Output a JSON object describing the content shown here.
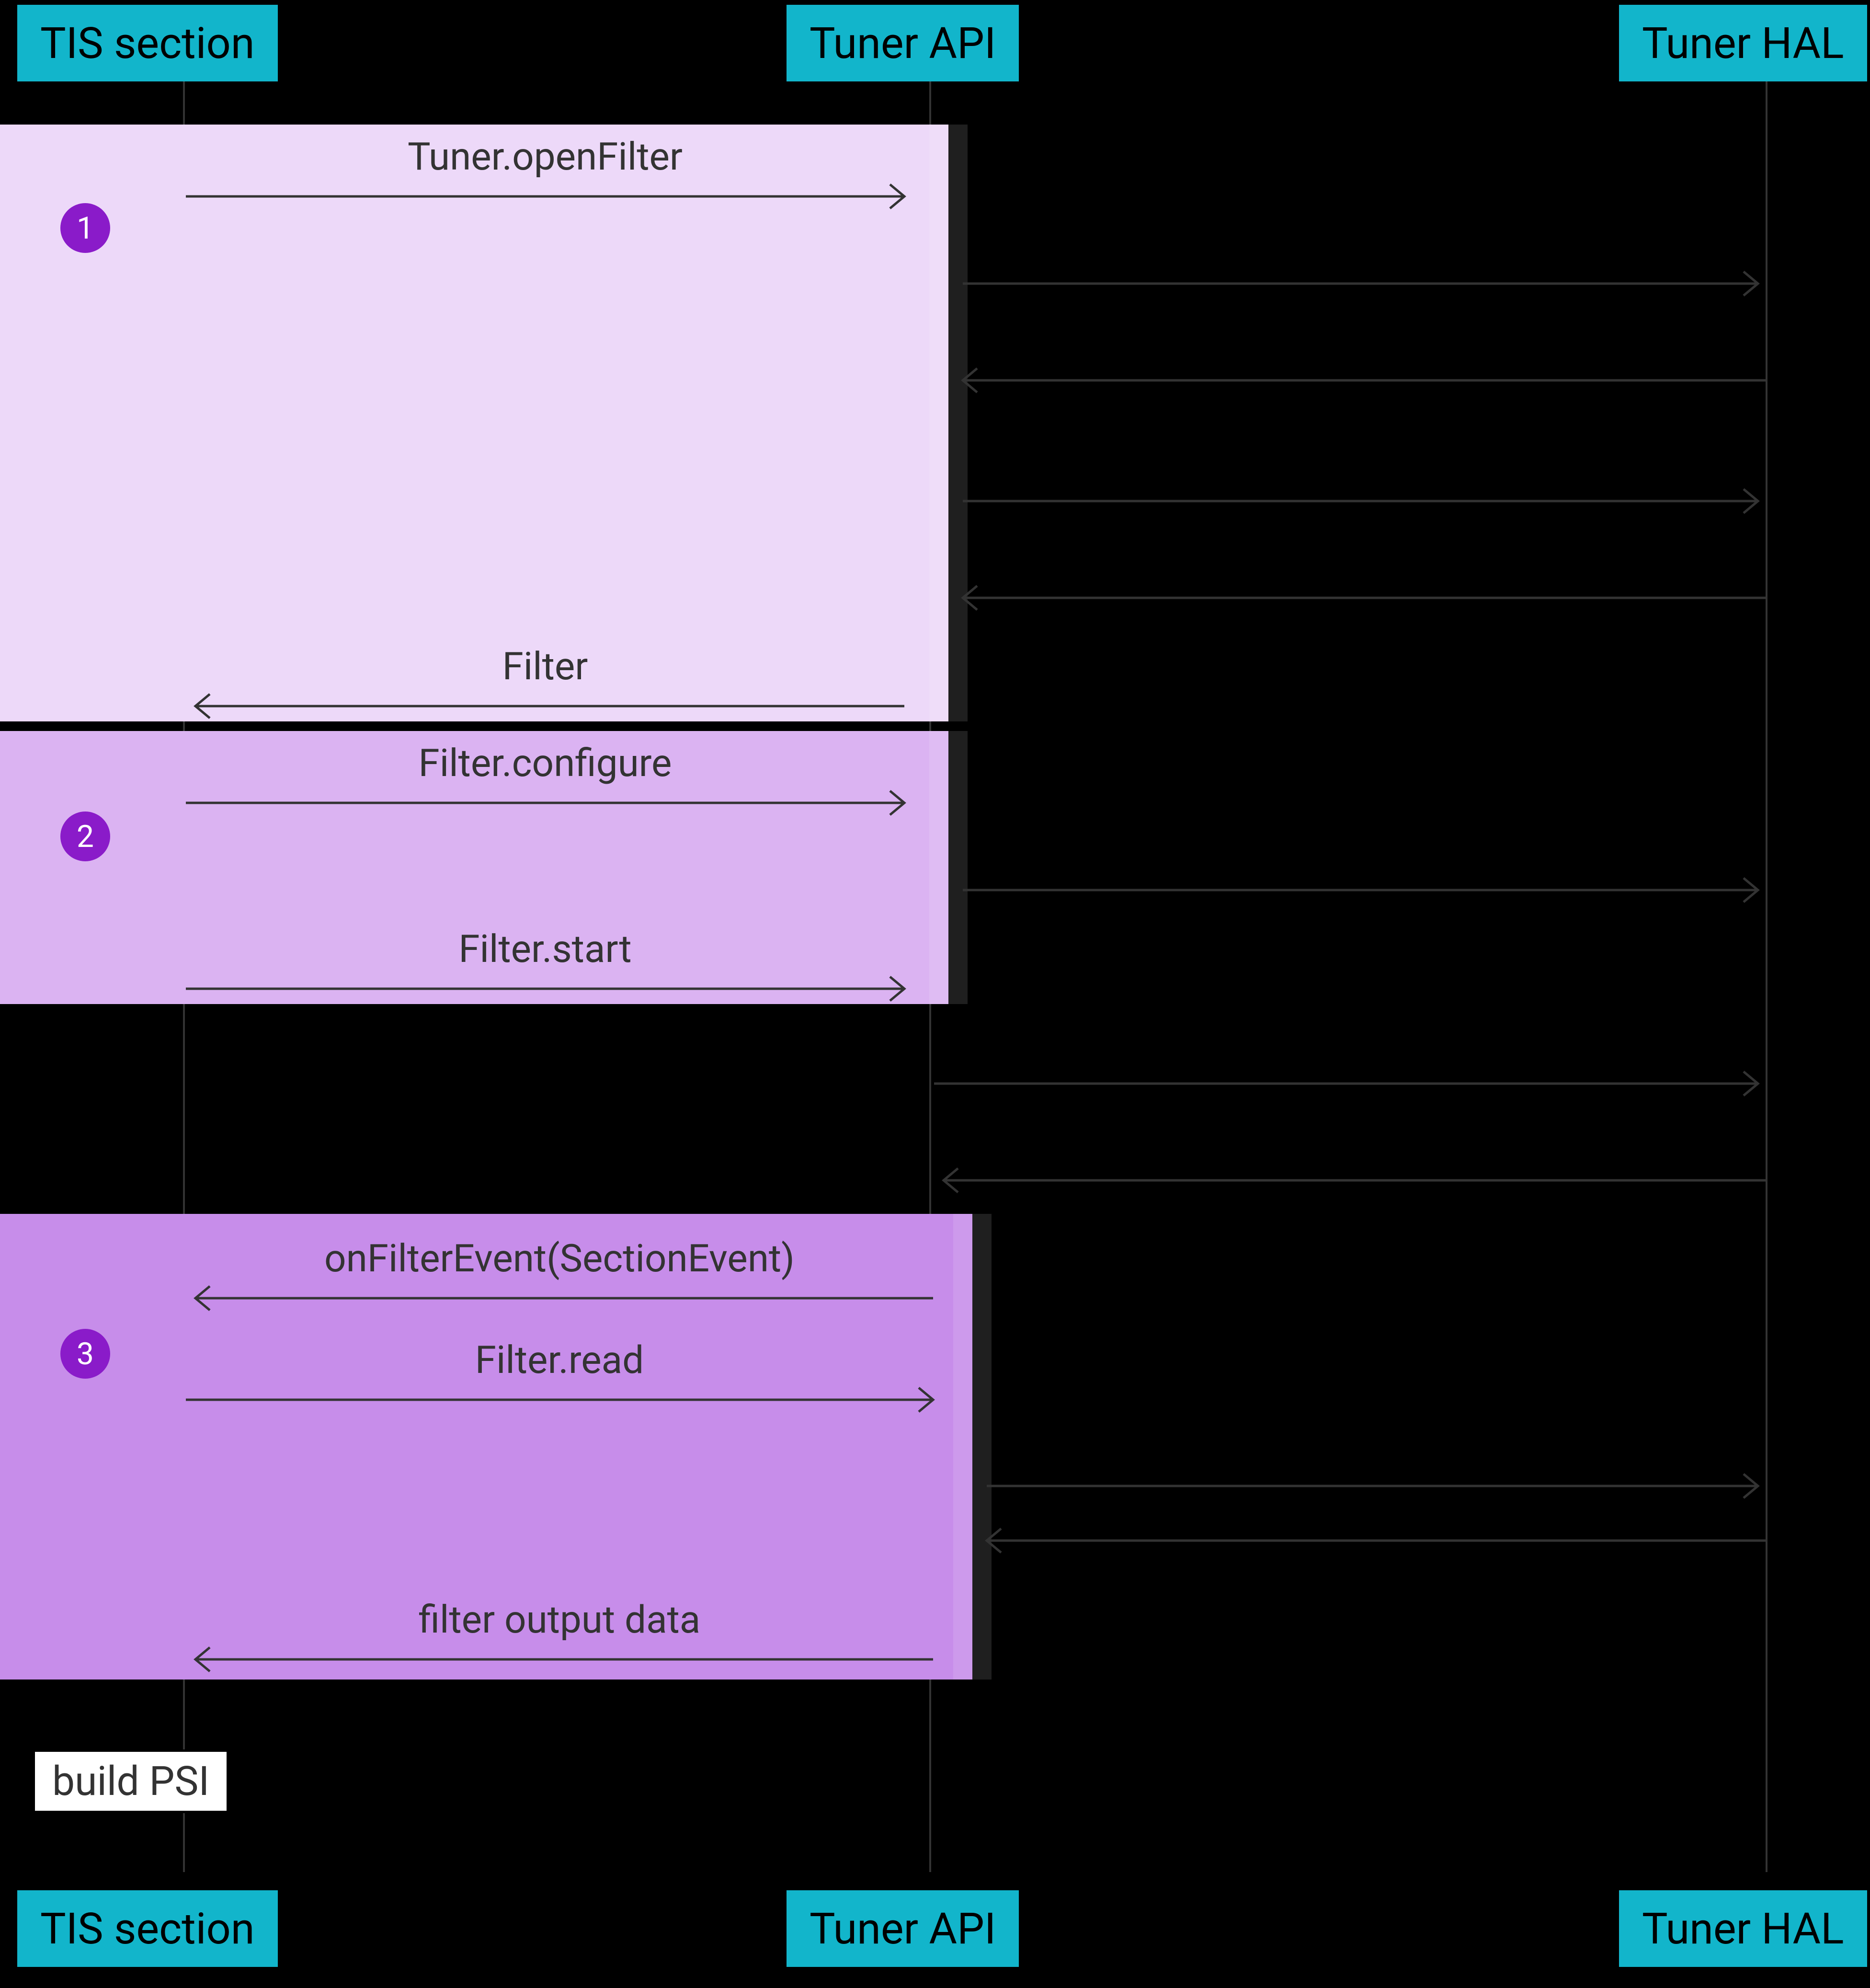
{
  "participants": {
    "tis": "TIS section",
    "api": "Tuner API",
    "hal": "Tuner HAL"
  },
  "stages": {
    "s1": "1",
    "s2": "2",
    "s3": "3"
  },
  "messages": {
    "openFilter": "Tuner.openFilter",
    "filterReturn": "Filter",
    "configure": "Filter.configure",
    "start": "Filter.start",
    "onFilterEvent": "onFilterEvent(SectionEvent)",
    "read": "Filter.read",
    "outputData": "filter output data"
  },
  "note": {
    "buildPSI": "build PSI"
  }
}
